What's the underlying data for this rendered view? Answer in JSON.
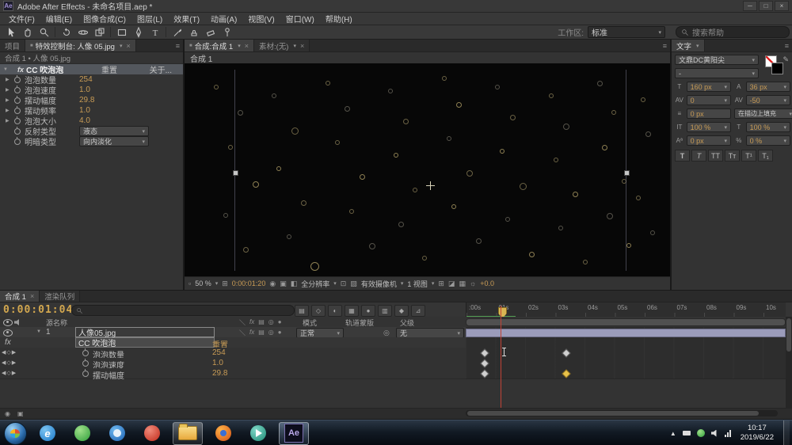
{
  "window": {
    "title": "Adobe After Effects - 未命名项目.aep *"
  },
  "menu": {
    "items": [
      "文件(F)",
      "编辑(E)",
      "图像合成(C)",
      "图层(L)",
      "效果(T)",
      "动画(A)",
      "视图(V)",
      "窗口(W)",
      "帮助(H)"
    ]
  },
  "toolbar": {
    "workspace_label": "工作区:",
    "workspace_value": "标准",
    "help_search": "搜索帮助"
  },
  "effect_panel": {
    "tab_project": "项目",
    "tab_active": "特效控制台: 人像 05.jpg",
    "breadcrumb": "合成 1 • 人像 05.jpg",
    "effect_badge": "fx",
    "effect_name": "CC 吹泡泡",
    "reset_label": "重置",
    "about_label": "关于...",
    "rows": [
      {
        "label": "泡泡数量",
        "value": "254",
        "kind": "value"
      },
      {
        "label": "泡泡速度",
        "value": "1.0",
        "kind": "value"
      },
      {
        "label": "摆动幅度",
        "value": "29.8",
        "kind": "value"
      },
      {
        "label": "摆动频率",
        "value": "1.0",
        "kind": "value"
      },
      {
        "label": "泡泡大小",
        "value": "4.0",
        "kind": "value"
      },
      {
        "label": "反射类型",
        "value": "液态",
        "kind": "dropdown"
      },
      {
        "label": "明暗类型",
        "value": "向内淡化",
        "kind": "dropdown"
      }
    ]
  },
  "comp_panel": {
    "tab_comp": "合成:合成 1",
    "tab_footage": "素材:(无)",
    "breadcrumb": "合成 1",
    "zoom": "50 %",
    "timecode": "0:00:01:20",
    "resolution": "全分辨率",
    "camera": "有效摄像机",
    "view": "1 视图",
    "exposure": "+0.0",
    "bubbles": [
      [
        6,
        10,
        4,
        0
      ],
      [
        11,
        22,
        5,
        1
      ],
      [
        9,
        38,
        4,
        0
      ],
      [
        14,
        55,
        6,
        2
      ],
      [
        8,
        70,
        4,
        1
      ],
      [
        12,
        86,
        5,
        0
      ],
      [
        18,
        14,
        4,
        1
      ],
      [
        22,
        30,
        7,
        0
      ],
      [
        19,
        48,
        4,
        2
      ],
      [
        24,
        64,
        5,
        0
      ],
      [
        21,
        80,
        4,
        1
      ],
      [
        26,
        93,
        9,
        2
      ],
      [
        29,
        8,
        4,
        0
      ],
      [
        33,
        20,
        5,
        1
      ],
      [
        31,
        36,
        4,
        0
      ],
      [
        36,
        52,
        5,
        2
      ],
      [
        34,
        68,
        4,
        0
      ],
      [
        38,
        84,
        6,
        1
      ],
      [
        42,
        12,
        4,
        1
      ],
      [
        45,
        26,
        5,
        0
      ],
      [
        43,
        42,
        4,
        2
      ],
      [
        47,
        58,
        4,
        0
      ],
      [
        44,
        74,
        5,
        1
      ],
      [
        49,
        90,
        4,
        0
      ],
      [
        53,
        6,
        4,
        0
      ],
      [
        56,
        18,
        5,
        2
      ],
      [
        54,
        34,
        4,
        1
      ],
      [
        58,
        50,
        6,
        0
      ],
      [
        55,
        66,
        4,
        2
      ],
      [
        60,
        82,
        5,
        1
      ],
      [
        64,
        10,
        4,
        1
      ],
      [
        67,
        24,
        5,
        0
      ],
      [
        65,
        40,
        4,
        2
      ],
      [
        69,
        56,
        7,
        0
      ],
      [
        66,
        72,
        4,
        1
      ],
      [
        71,
        88,
        5,
        2
      ],
      [
        75,
        14,
        4,
        0
      ],
      [
        78,
        28,
        6,
        1
      ],
      [
        76,
        44,
        4,
        0
      ],
      [
        80,
        60,
        5,
        2
      ],
      [
        77,
        76,
        4,
        1
      ],
      [
        82,
        92,
        4,
        0
      ],
      [
        85,
        8,
        5,
        1
      ],
      [
        88,
        22,
        4,
        0
      ],
      [
        86,
        38,
        5,
        2
      ],
      [
        90,
        54,
        4,
        0
      ],
      [
        87,
        70,
        6,
        1
      ],
      [
        91,
        84,
        4,
        2
      ],
      [
        94,
        16,
        4,
        0
      ],
      [
        95,
        32,
        5,
        1
      ],
      [
        93,
        62,
        4,
        0
      ],
      [
        96,
        78,
        4,
        1
      ]
    ]
  },
  "character_panel": {
    "tab": "文字",
    "font_family": "文鼎DC黄阳尖",
    "font_style": "-",
    "font_size": "160 px",
    "leading": "36 px",
    "kerning": "0",
    "tracking": "-50",
    "stroke_width": "0 px",
    "fill_stroke": "在描边上填充",
    "v_scale": "100 %",
    "h_scale": "100 %",
    "baseline": "0 px",
    "tsume": "0 %",
    "toggles": [
      "T",
      "T",
      "TT",
      "Tᴛ",
      "T¹",
      "T₁"
    ]
  },
  "timeline": {
    "tab_comp": "合成 1",
    "tab_render": "渲染队列",
    "timecode": "0:00:01:04",
    "columns": {
      "source": "源名称",
      "mode": "模式",
      "trkmat": "轨道蒙版",
      "parent": "父级"
    },
    "layer": {
      "index": "1",
      "name": "人像05.jpg",
      "mode": "正常",
      "parent": "无"
    },
    "effect_name": "CC 吹泡泡",
    "reset_label": "重置",
    "props": [
      {
        "label": "泡泡数量",
        "value": "254",
        "keys": [
          5.6,
          31.1
        ],
        "selected_key": -1
      },
      {
        "label": "泡泡速度",
        "value": "1.0",
        "keys": [
          5.6
        ],
        "selected_key": -1
      },
      {
        "label": "摆动幅度",
        "value": "29.8",
        "keys": [
          5.6,
          31.1
        ],
        "selected_key": 1
      }
    ],
    "ruler": [
      ":00s",
      "01s",
      "02s",
      "03s",
      "04s",
      "05s",
      "06s",
      "07s",
      "08s",
      "09s",
      "10s"
    ],
    "cti_percent": 10.9,
    "cache_end_percent": 15.5
  },
  "taskbar": {
    "clock_time": "10:17",
    "clock_date": "2019/6/22"
  },
  "colors": {
    "value_gold": "#c89b55",
    "timecode_gold": "#d2a74f",
    "cti_red": "#c14236",
    "key_selected": "#e8c24a",
    "layer_bar": "#9b9cba",
    "cache_green": "#55a055"
  }
}
